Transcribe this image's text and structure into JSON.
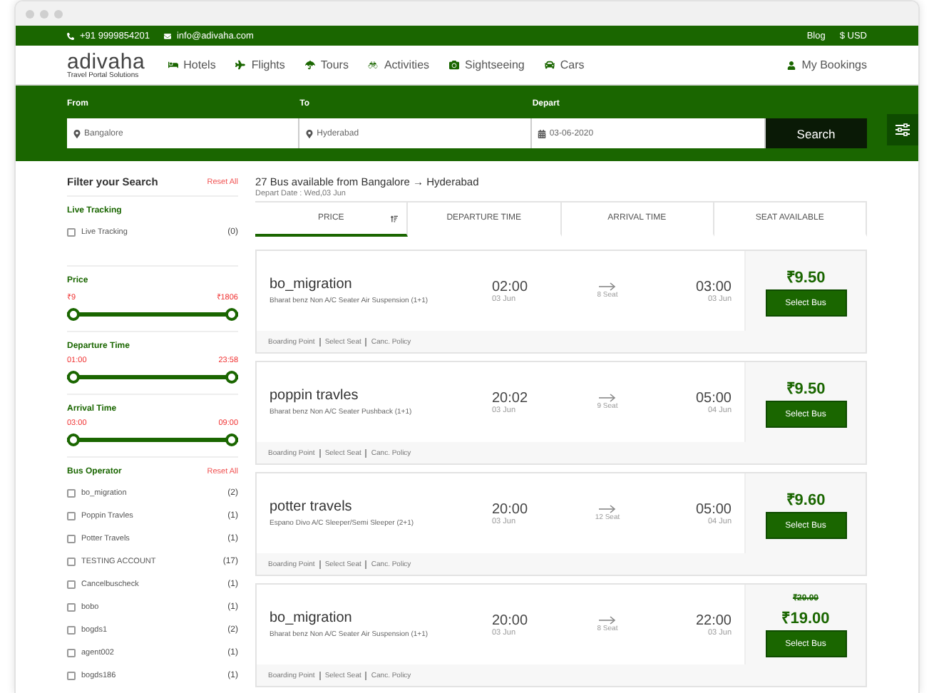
{
  "topbar": {
    "phone": "+91 9999854201",
    "email": "info@adivaha.com",
    "links": [
      "Blog",
      "$ USD"
    ]
  },
  "logo": {
    "name": "adivaha",
    "tagline": "Travel Portal Solutions"
  },
  "nav": [
    {
      "label": "Hotels"
    },
    {
      "label": "Flights"
    },
    {
      "label": "Tours"
    },
    {
      "label": "Activities"
    },
    {
      "label": "Sightseeing"
    },
    {
      "label": "Cars"
    }
  ],
  "my_bookings": "My Bookings",
  "search": {
    "fields": [
      {
        "label": "From",
        "value": "Bangalore"
      },
      {
        "label": "To",
        "value": "Hyderabad"
      },
      {
        "label": "Depart",
        "value": "03-06-2020"
      }
    ],
    "button": "Search"
  },
  "filters": {
    "title": "Filter your Search",
    "reset": "Reset All",
    "live_tracking": {
      "title": "Live Tracking",
      "items": [
        {
          "label": "Live Tracking",
          "count": "(0)",
          "checked": false
        }
      ]
    },
    "ranges": [
      {
        "title": "Price",
        "min": "₹9",
        "max": "₹1806",
        "level": 1
      },
      {
        "title": "Departure Time",
        "min": "01:00",
        "max": "23:58",
        "level": 1
      },
      {
        "title": "Arrival Time",
        "min": "03:00",
        "max": "09:00",
        "level": 1
      }
    ],
    "operators": {
      "title": "Bus Operator",
      "reset": "Reset All",
      "items": [
        {
          "label": "bo_migration",
          "count": "(2)",
          "checked": false
        },
        {
          "label": "Poppin Travles",
          "count": "(1)",
          "checked": false
        },
        {
          "label": "Potter Travels",
          "count": "(1)",
          "checked": false
        },
        {
          "label": "TESTING ACCOUNT",
          "count": "(17)",
          "checked": false
        },
        {
          "label": "Cancelbuscheck",
          "count": "(1)",
          "checked": false
        },
        {
          "label": "bobo",
          "count": "(1)",
          "checked": false
        },
        {
          "label": "bogds1",
          "count": "(2)",
          "checked": false
        },
        {
          "label": "agent002",
          "count": "(1)",
          "checked": false
        },
        {
          "label": "bogds186",
          "count": "(1)",
          "checked": false
        }
      ]
    }
  },
  "results": {
    "heading": "27 Bus available from Bangalore → Hyderabad",
    "subheading": "Depart Date : Wed,03 Jun",
    "sort_tabs": [
      {
        "label": "PRICE",
        "selected": true
      },
      {
        "label": "DEPARTURE TIME",
        "selected": false
      },
      {
        "label": "ARRIVAL TIME",
        "selected": false
      },
      {
        "label": "SEAT AVAILABLE",
        "selected": false
      }
    ],
    "buses": [
      {
        "name": "bo_migration",
        "type": "Bharat benz Non A/C Seater Air Suspension (1+1)",
        "dep_time": "02:00",
        "dep_date": "03 Jun",
        "seats": "8 Seat",
        "arr_time": "03:00",
        "arr_date": "03 Jun",
        "price": "₹9.50",
        "button": "Select Bus",
        "links": [
          "Boarding Point",
          "Select Seat",
          "Canc. Policy"
        ]
      },
      {
        "name": "poppin travles",
        "type": "Bharat benz Non A/C Seater Pushback (1+1)",
        "dep_time": "20:02",
        "dep_date": "03 Jun",
        "seats": "9 Seat",
        "arr_time": "05:00",
        "arr_date": "04 Jun",
        "price": "₹9.50",
        "button": "Select Bus",
        "links": [
          "Boarding Point",
          "Select Seat",
          "Canc. Policy"
        ]
      },
      {
        "name": "potter travels",
        "type": "Espano Divo A/C Sleeper/Semi Sleeper (2+1)",
        "dep_time": "20:00",
        "dep_date": "03 Jun",
        "seats": "12 Seat",
        "arr_time": "05:00",
        "arr_date": "04 Jun",
        "price": "₹9.60",
        "button": "Select Bus",
        "links": [
          "Boarding Point",
          "Select Seat",
          "Canc. Policy"
        ]
      },
      {
        "name": "bo_migration",
        "type": "Bharat benz Non A/C Seater Air Suspension (1+1)",
        "dep_time": "20:00",
        "dep_date": "03 Jun",
        "seats": "8 Seat",
        "arr_time": "22:00",
        "arr_date": "03 Jun",
        "old_price": "₹20.00",
        "price": "₹19.00",
        "button": "Select Bus",
        "links": [
          "Boarding Point",
          "Select Seat",
          "Canc. Policy"
        ]
      }
    ]
  }
}
